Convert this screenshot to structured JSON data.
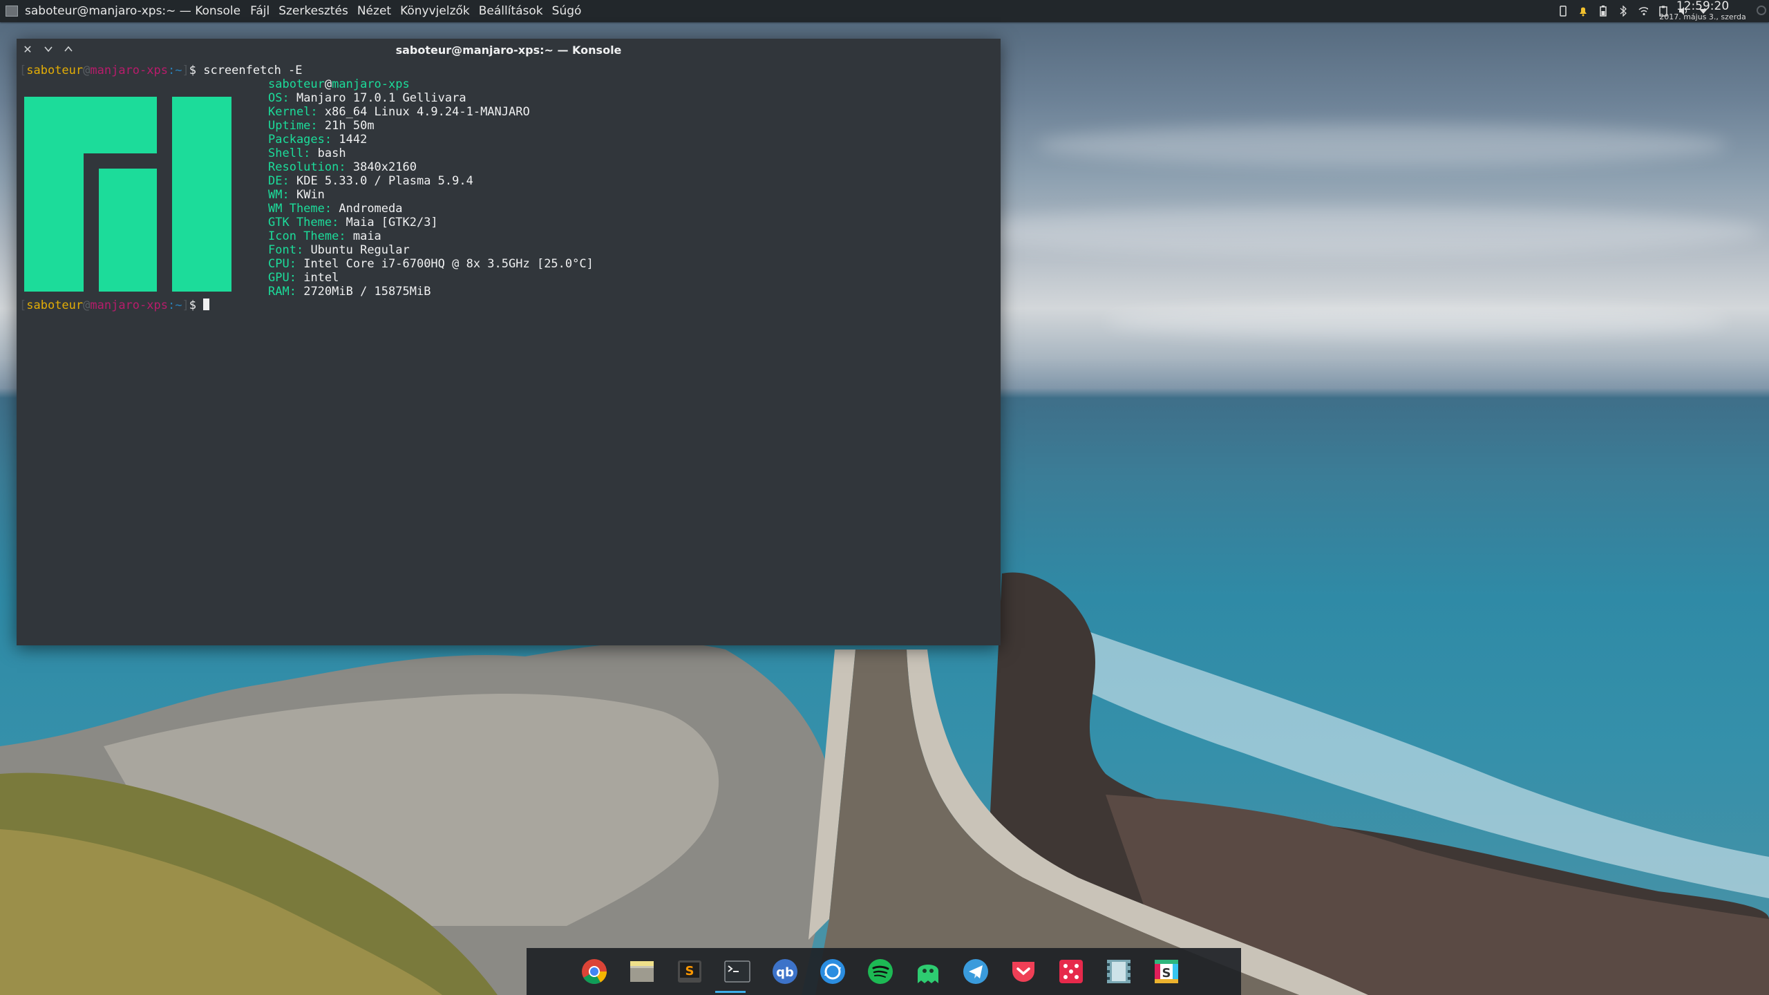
{
  "top_panel": {
    "window_title": "saboteur@manjaro-xps:~ — Konsole",
    "menu": [
      "Fájl",
      "Szerkesztés",
      "Nézet",
      "Könyvjelzők",
      "Beállítások",
      "Súgó"
    ],
    "tray_icons": [
      "phone-icon",
      "notification-bell-icon",
      "battery-icon",
      "bluetooth-icon",
      "wifi-icon",
      "clipboard-icon",
      "volume-icon",
      "expand-arrow-icon"
    ],
    "clock": {
      "time": "12:59:20",
      "date": "2017. május 3., szerda"
    }
  },
  "konsole": {
    "title": "saboteur@manjaro-xps:~ — Konsole",
    "prompt": {
      "open": "[",
      "user": "saboteur",
      "at": "@",
      "host": "manjaro-xps",
      "path": ":~",
      "close": "]",
      "symbol": "$"
    },
    "command": "screenfetch -E",
    "info_header": {
      "user": "saboteur",
      "at": "@",
      "host": "manjaro-xps"
    },
    "info": [
      {
        "label": "OS:",
        "value": "Manjaro 17.0.1 Gellivara"
      },
      {
        "label": "Kernel:",
        "value": "x86_64 Linux 4.9.24-1-MANJARO"
      },
      {
        "label": "Uptime:",
        "value": "21h 50m"
      },
      {
        "label": "Packages:",
        "value": "1442"
      },
      {
        "label": "Shell:",
        "value": "bash"
      },
      {
        "label": "Resolution:",
        "value": "3840x2160"
      },
      {
        "label": "DE:",
        "value": "KDE 5.33.0 / Plasma 5.9.4"
      },
      {
        "label": "WM:",
        "value": "KWin"
      },
      {
        "label": "WM Theme:",
        "value": "Andromeda"
      },
      {
        "label": "GTK Theme:",
        "value": "Maia [GTK2/3]"
      },
      {
        "label": "Icon Theme:",
        "value": "maia"
      },
      {
        "label": "Font:",
        "value": "Ubuntu Regular"
      },
      {
        "label": "CPU:",
        "value": "Intel Core i7-6700HQ @ 8x 3.5GHz [25.0°C]"
      },
      {
        "label": "GPU:",
        "value": "intel"
      },
      {
        "label": "RAM:",
        "value": "2720MiB / 15875MiB"
      }
    ]
  },
  "dock": {
    "items": [
      "chrome-icon",
      "file-manager-icon",
      "sublime-text-icon",
      "konsole-icon",
      "qbittorrent-icon",
      "sync-icon",
      "spotify-icon",
      "ghost-icon",
      "telegram-icon",
      "pocket-icon",
      "dice-icon",
      "video-player-icon",
      "slack-icon"
    ],
    "active": "konsole-icon"
  },
  "colors": {
    "accent": "#3daee9",
    "manjaro_green": "#1cdc9a",
    "terminal_bg": "#31363b",
    "prompt_user": "#e3ad06",
    "prompt_host": "#b81c6b"
  }
}
